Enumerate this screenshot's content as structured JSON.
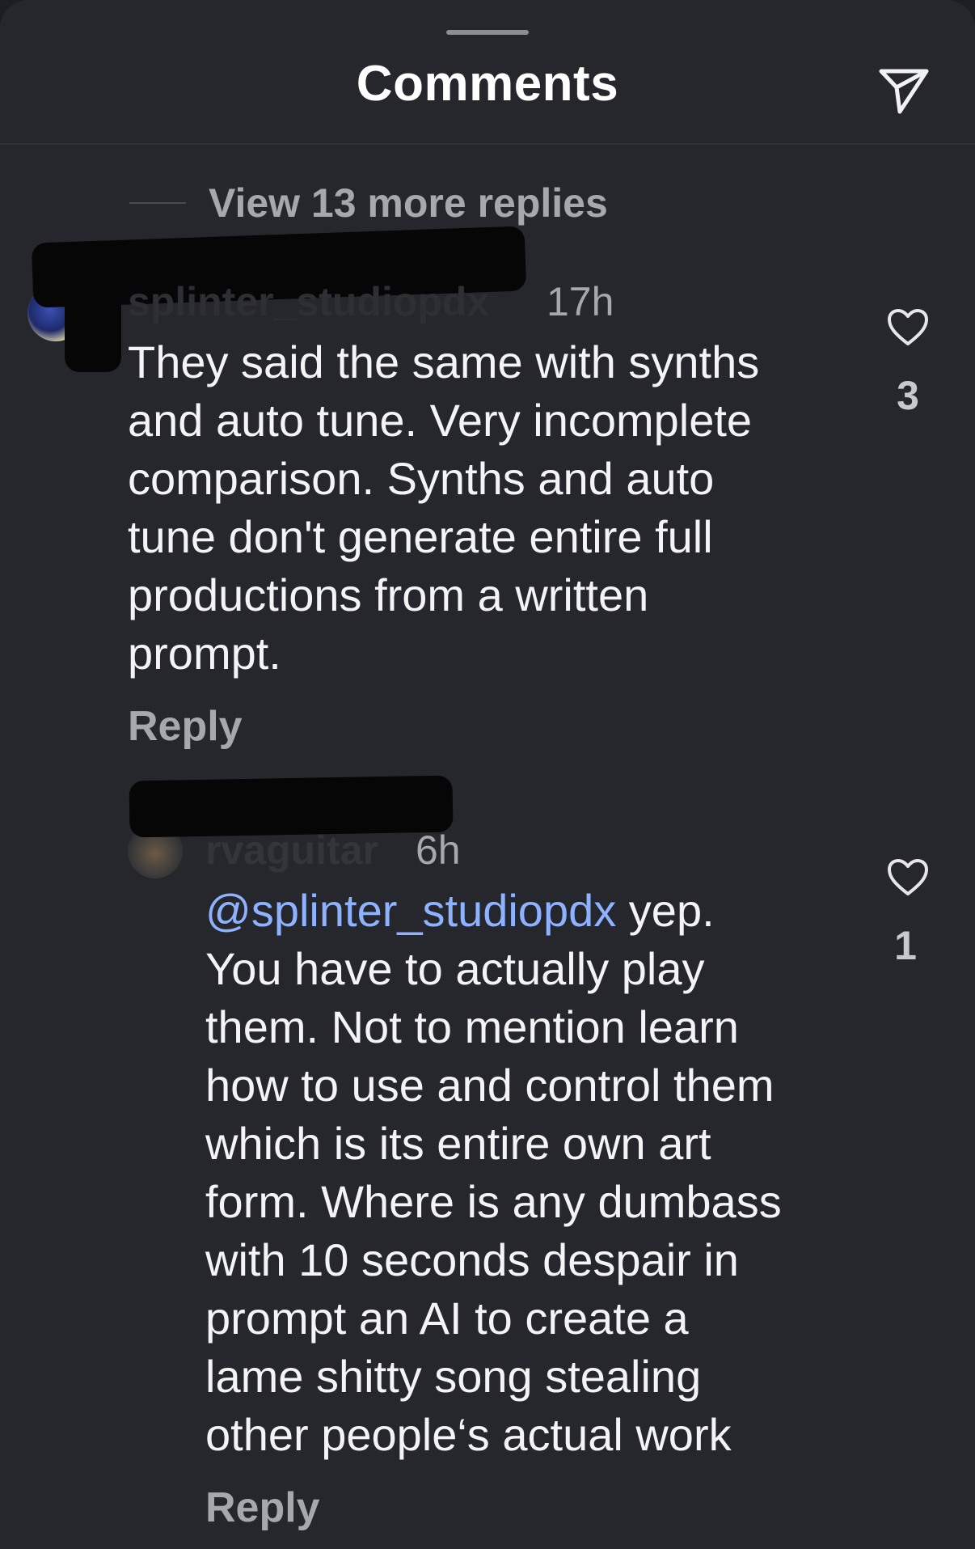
{
  "header": {
    "title": "Comments"
  },
  "thread": {
    "view_more_label": "View 13 more replies"
  },
  "comments": [
    {
      "username": "splinter_studiopdx",
      "time": "17h",
      "text": "They said the same with synths\nand auto tune. Very incomplete\ncomparison. Synths and auto\ntune don't generate entire full\nproductions from a written\nprompt.",
      "reply_label": "Reply",
      "likes": "3"
    },
    {
      "username": "rvaguitar",
      "time": "6h",
      "mention": "@splinter_studiopdx",
      "text_after_mention": " yep.\nYou have to actually play\nthem. Not to mention learn\nhow to use and control them\nwhich is its entire own art\nform. Where is any dumbass\nwith 10 seconds despair in\nprompt an AI to create a\nlame shitty song stealing\nother people‘s actual work",
      "reply_label": "Reply",
      "likes": "1"
    }
  ],
  "icons": {
    "share": "paper-plane-icon",
    "like": "heart-outline-icon"
  },
  "colors": {
    "background": "#25272d",
    "text": "#f4f4f6",
    "secondary_text": "#a6a8ae",
    "mention": "#8fb2ff"
  }
}
